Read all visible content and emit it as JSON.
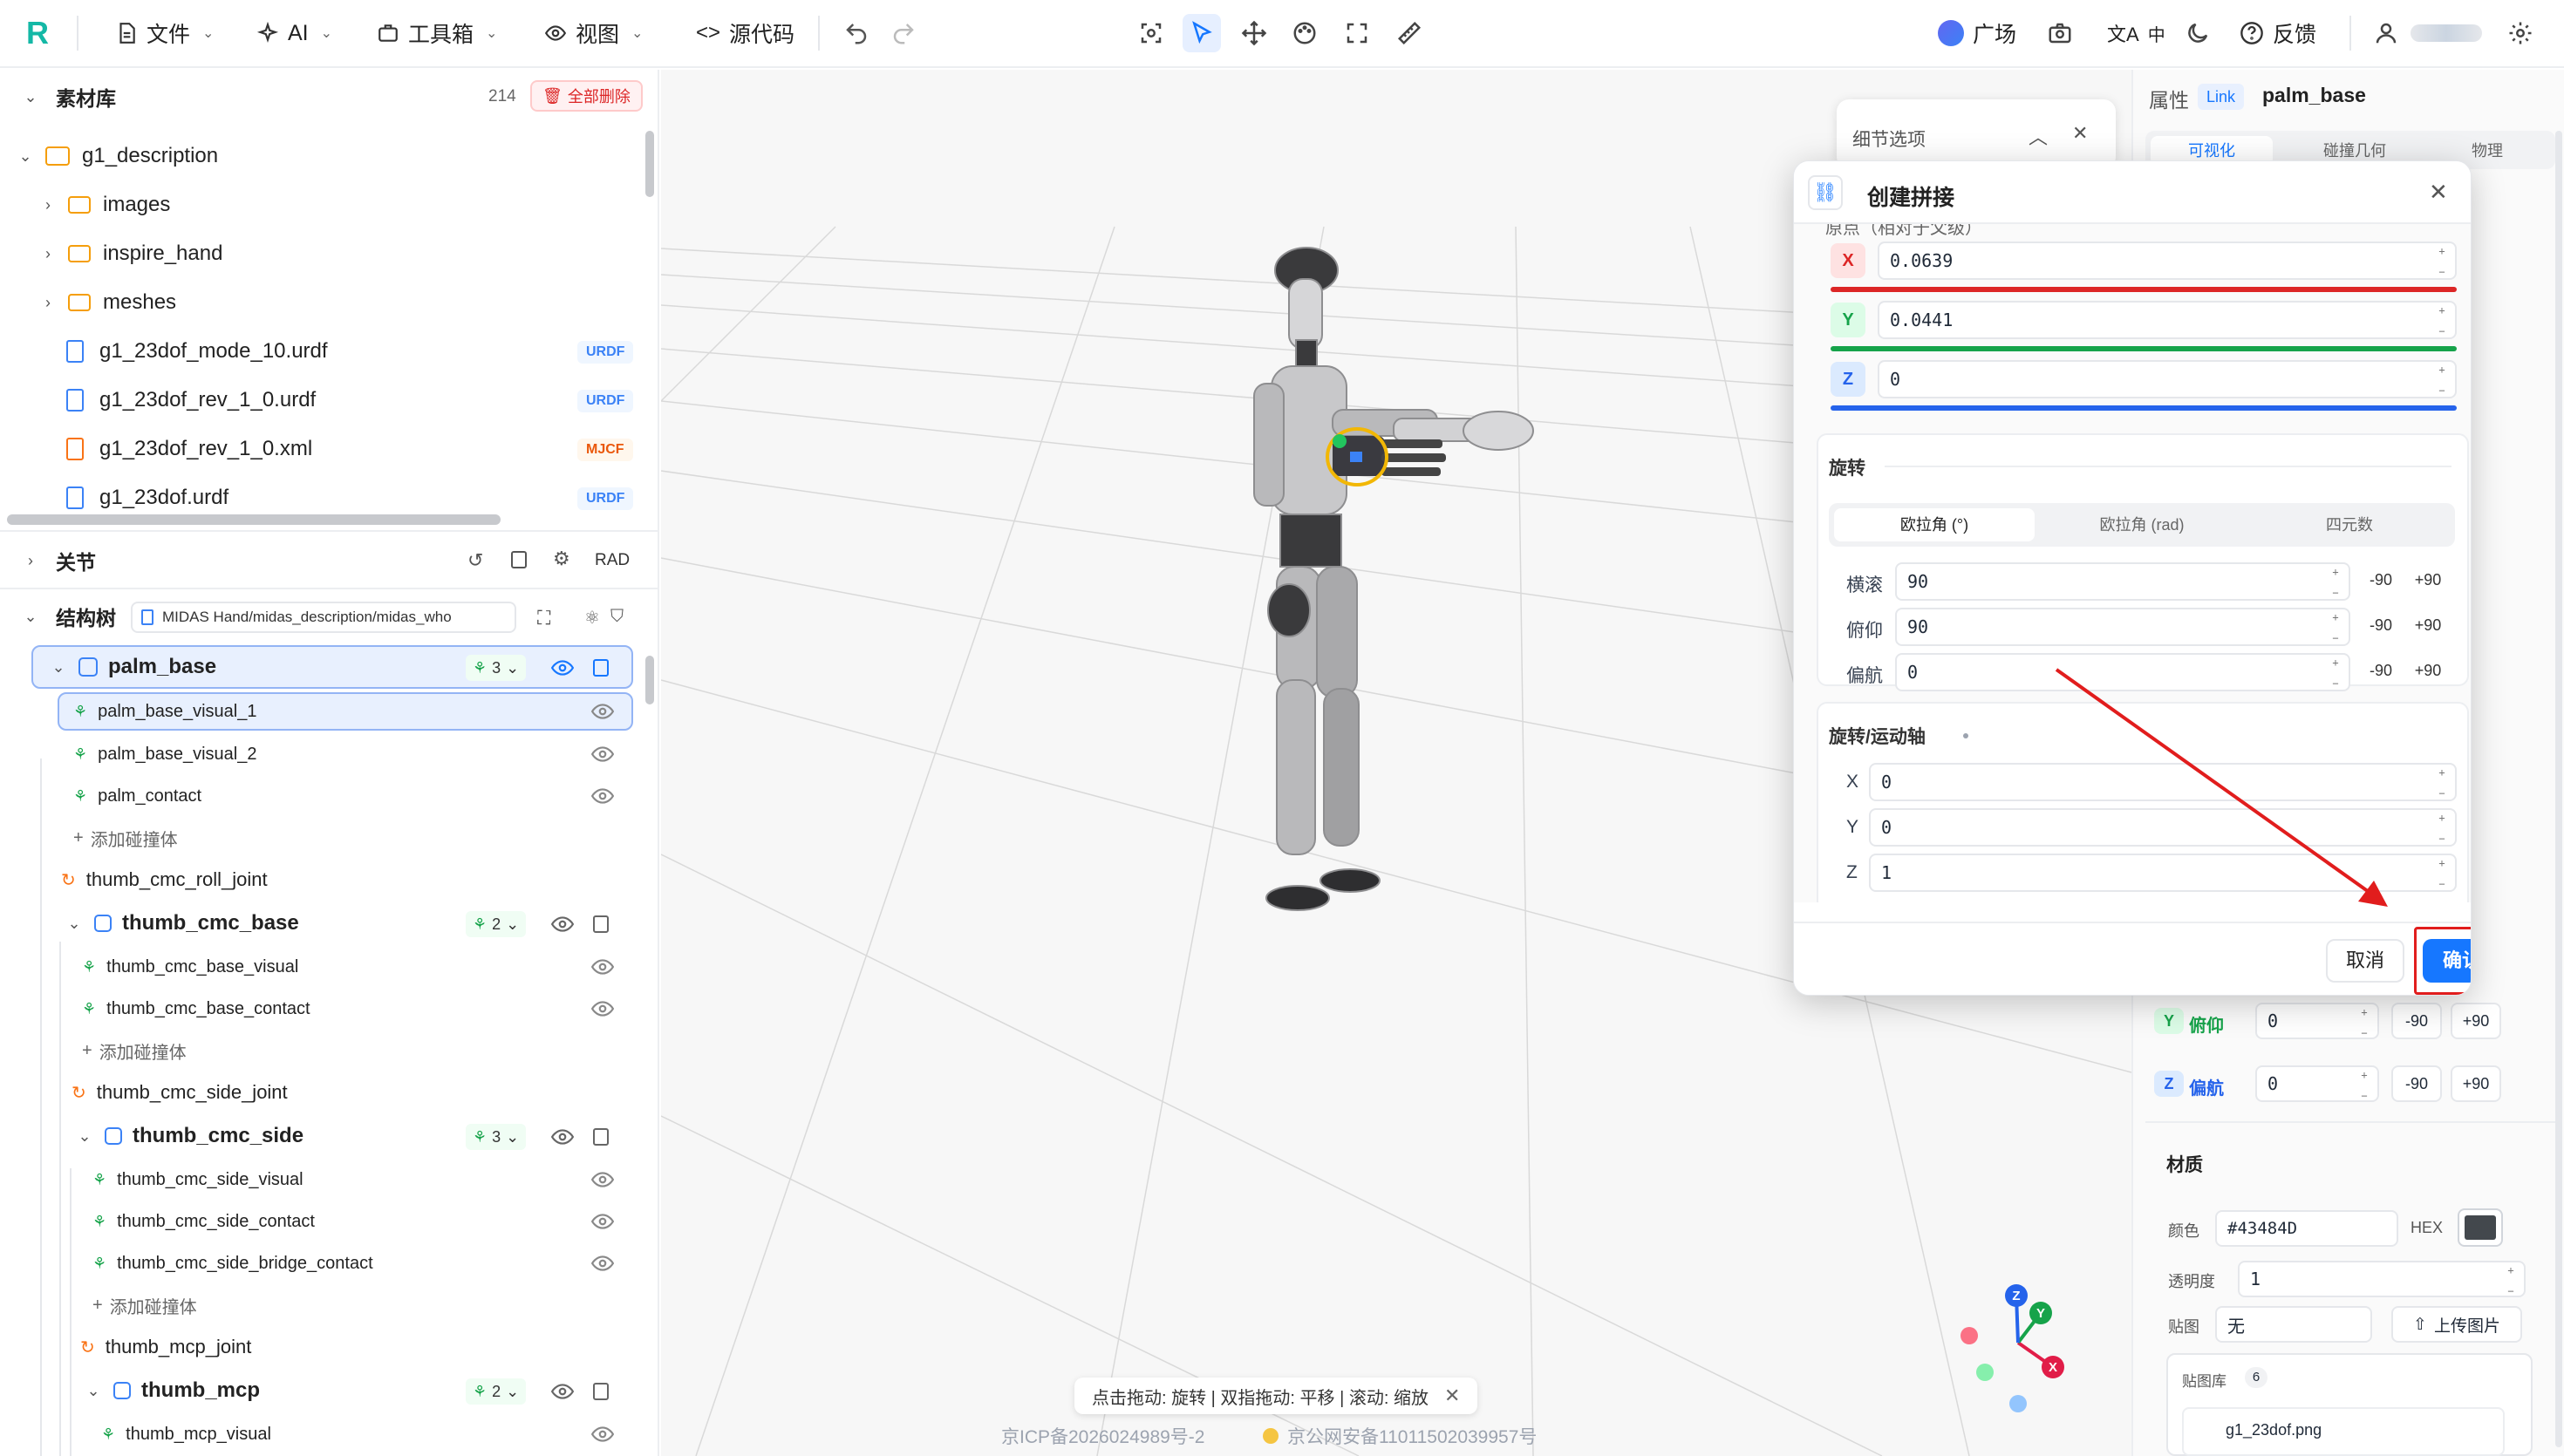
{
  "toolbar": {
    "logo": "R",
    "file": "文件",
    "ai": "AI",
    "toolbox": "工具箱",
    "view": "视图",
    "source": "源代码",
    "square": "广场",
    "lang": "中",
    "feedback": "反馈"
  },
  "assets": {
    "title": "素材库",
    "count": "214",
    "delete_all": "全部删除",
    "root": "g1_description",
    "folders": [
      "images",
      "inspire_hand",
      "meshes"
    ],
    "files": [
      {
        "name": "g1_23dof_mode_10.urdf",
        "tag": "URDF"
      },
      {
        "name": "g1_23dof_rev_1_0.urdf",
        "tag": "URDF"
      },
      {
        "name": "g1_23dof_rev_1_0.xml",
        "tag": "MJCF"
      },
      {
        "name": "g1_23dof.urdf",
        "tag": "URDF"
      }
    ]
  },
  "joints": {
    "title": "关节",
    "rad": "RAD"
  },
  "structure": {
    "title": "结构树",
    "file": "MIDAS Hand/midas_description/midas_who",
    "palm_base": "palm_base",
    "palm_base_count": "3",
    "palm_base_visual_1": "palm_base_visual_1",
    "palm_base_visual_2": "palm_base_visual_2",
    "palm_contact": "palm_contact",
    "add_collision": "添加碰撞体",
    "thumb_cmc_roll_joint": "thumb_cmc_roll_joint",
    "thumb_cmc_base": "thumb_cmc_base",
    "thumb_cmc_base_count": "2",
    "thumb_cmc_base_visual": "thumb_cmc_base_visual",
    "thumb_cmc_base_contact": "thumb_cmc_base_contact",
    "thumb_cmc_side_joint": "thumb_cmc_side_joint",
    "thumb_cmc_side": "thumb_cmc_side",
    "thumb_cmc_side_count": "3",
    "thumb_cmc_side_visual": "thumb_cmc_side_visual",
    "thumb_cmc_side_contact": "thumb_cmc_side_contact",
    "thumb_cmc_side_bridge_contact": "thumb_cmc_side_bridge_contact",
    "thumb_mcp_joint": "thumb_mcp_joint",
    "thumb_mcp": "thumb_mcp",
    "thumb_mcp_count": "2",
    "thumb_mcp_visual": "thumb_mcp_visual"
  },
  "viewport": {
    "hint": "点击拖动: 旋转 | 双指拖动: 平移 | 滚动: 缩放",
    "icp": "京ICP备2026024989号-2",
    "police": "京公网安备11011502039957号",
    "gizmo": {
      "x": "X",
      "y": "Y",
      "z": "Z"
    }
  },
  "detail": {
    "title": "细节选项"
  },
  "properties": {
    "title": "属性",
    "type": "Link",
    "name": "palm_base",
    "tabs": [
      "可视化",
      "碰撞几何",
      "物理"
    ],
    "pitch_label": "俯仰",
    "pitch": "0",
    "yaw_label": "偏航",
    "yaw": "0",
    "minus90": "-90",
    "plus90": "+90",
    "material_title": "材质",
    "color_label": "颜色",
    "color": "#43484D",
    "hex": "HEX",
    "opacity_label": "透明度",
    "opacity": "1",
    "texture_label": "贴图",
    "texture": "无",
    "upload": "上传图片",
    "library": "贴图库",
    "library_count": "6",
    "library_file": "g1_23dof.png"
  },
  "dialog": {
    "title": "创建拼接",
    "origin_label": "原点（相对于父级）",
    "x": "0.0639",
    "y": "0.0441",
    "z": "0",
    "rotation_title": "旋转",
    "rot_tabs": [
      "欧拉角 (°)",
      "欧拉角 (rad)",
      "四元数"
    ],
    "roll_label": "横滚",
    "roll": "90",
    "pitch_label": "俯仰",
    "pitch": "90",
    "yaw_label": "偏航",
    "yaw": "0",
    "minus90": "-90",
    "plus90": "+90",
    "axis_title": "旋转/运动轴",
    "axis_x": "0",
    "axis_y": "0",
    "axis_z": "1",
    "cancel": "取消",
    "confirm": "确认"
  },
  "colors": {
    "accent": "#1677ff",
    "x": "#dc2626",
    "y": "#16a34a",
    "z": "#2563eb",
    "annotation": "#e11d1d"
  }
}
